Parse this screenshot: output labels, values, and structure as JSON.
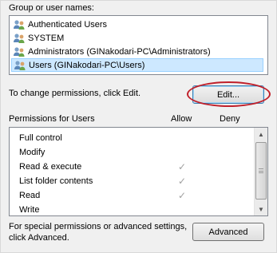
{
  "groups": {
    "label": "Group or user names:",
    "items": [
      {
        "label": "Authenticated Users",
        "icon": "users-icon"
      },
      {
        "label": "SYSTEM",
        "icon": "users-icon"
      },
      {
        "label": "Administrators (GINakodari-PC\\Administrators)",
        "icon": "users-icon"
      },
      {
        "label": "Users (GINakodari-PC\\Users)",
        "icon": "users-icon",
        "selected": true
      }
    ]
  },
  "change_text": "To change permissions, click Edit.",
  "edit_button": "Edit...",
  "permissions": {
    "label": "Permissions for Users",
    "allow_header": "Allow",
    "deny_header": "Deny",
    "rows": [
      {
        "name": "Full control",
        "allow": false,
        "deny": false
      },
      {
        "name": "Modify",
        "allow": false,
        "deny": false
      },
      {
        "name": "Read & execute",
        "allow": true,
        "deny": false
      },
      {
        "name": "List folder contents",
        "allow": true,
        "deny": false
      },
      {
        "name": "Read",
        "allow": true,
        "deny": false
      },
      {
        "name": "Write",
        "allow": false,
        "deny": false
      }
    ],
    "check_glyph": "✓"
  },
  "special_text_line1": "For special permissions or advanced settings,",
  "special_text_line2": "click Advanced.",
  "advanced_button": "Advanced",
  "colors": {
    "highlight": "#cde8ff",
    "annotation": "#c0202a"
  }
}
